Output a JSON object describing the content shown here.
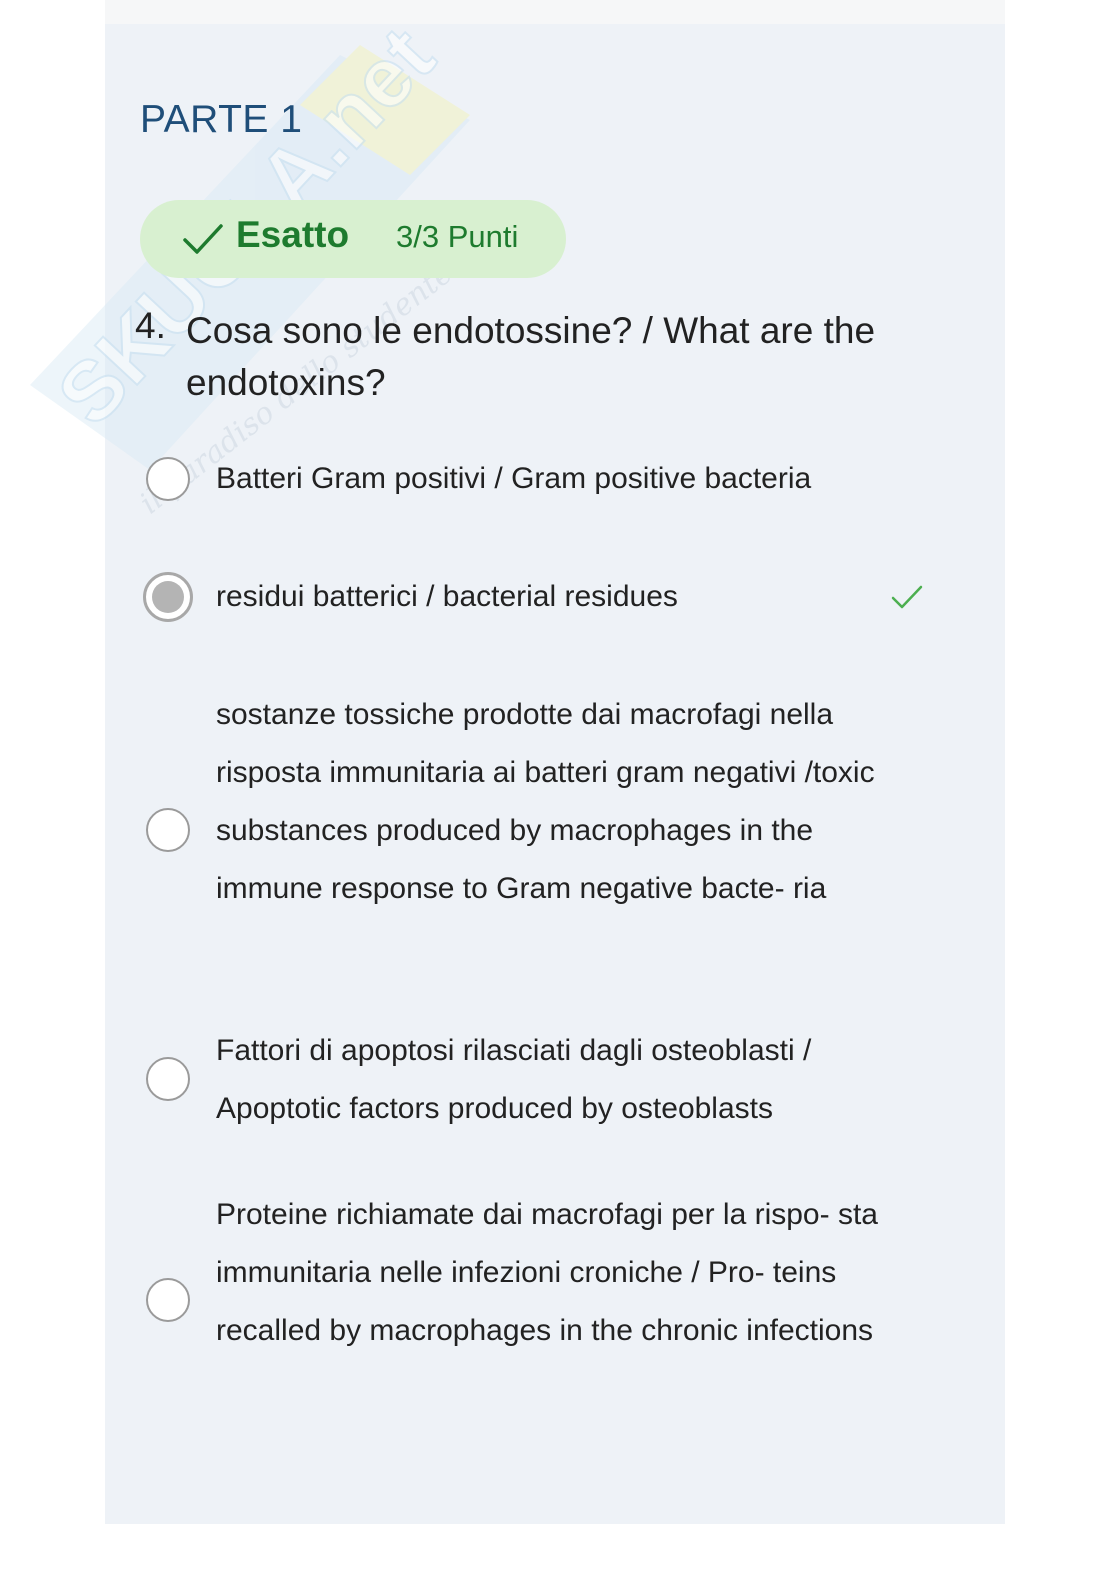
{
  "section": {
    "title": "PARTE 1"
  },
  "result": {
    "status": "Esatto",
    "score": "3/3 Punti",
    "check_icon": "checkmark-icon"
  },
  "question": {
    "number": "4.",
    "text": "Cosa sono le endotossine? / What are the endotoxins?"
  },
  "options": [
    {
      "text": "Batteri Gram positivi / Gram positive bacteria",
      "selected": false
    },
    {
      "text": "residui batterici / bacterial residues",
      "selected": true,
      "correct_icon": "checkmark-icon"
    },
    {
      "text": "sostanze tossiche prodotte dai macrofagi nella risposta immunitaria ai batteri gram negativi /toxic substances produced by macrophages in the immune response to Gram negative bacte- ria",
      "selected": false
    },
    {
      "text": "Fattori di apoptosi rilasciati dagli osteoblasti / Apoptotic factors produced by osteoblasts",
      "selected": false
    },
    {
      "text": "Proteine richiamate dai macrofagi per la rispo- sta immunitaria nelle infezioni croniche / Pro- teins recalled by macrophages in the chronic infections",
      "selected": false
    }
  ],
  "watermark": {
    "brand": "SKUOLA.net",
    "tagline": "il paradiso dello studente"
  },
  "colors": {
    "card_background": "#eef2f7",
    "title": "#1f4e79",
    "success_green": "#1e7b2e",
    "success_pill": "#d8f0d0",
    "check_light_green": "#4caf50"
  }
}
